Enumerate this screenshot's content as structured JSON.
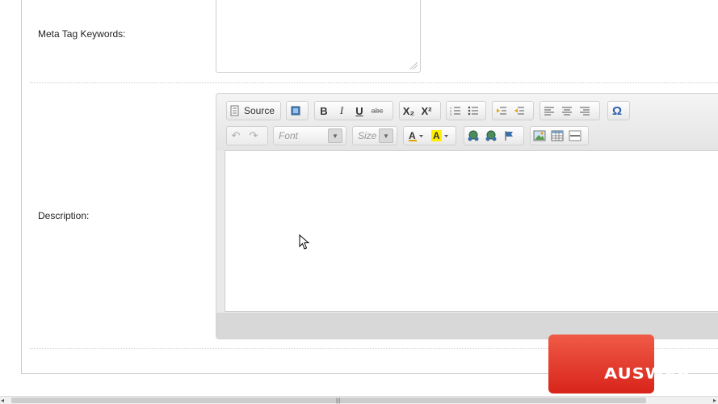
{
  "form": {
    "meta_keywords_label": "Meta Tag Keywords:",
    "description_label": "Description:"
  },
  "editor": {
    "source_label": "Source",
    "font_placeholder": "Font",
    "size_placeholder": "Size",
    "icons": {
      "source": "source-icon",
      "template": "template-icon",
      "bold": "B",
      "italic": "I",
      "underline": "U",
      "strike": "abc",
      "subscript": "X₂",
      "superscript": "X²",
      "special_char": "Ω"
    }
  },
  "watermark": {
    "text": "AUSWEB",
    "color": "#e03a2b"
  },
  "scrollbar": {
    "grip": "|||"
  }
}
